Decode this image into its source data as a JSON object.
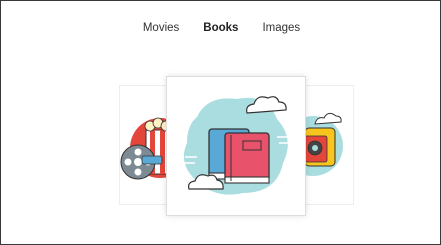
{
  "tabs": [
    {
      "label": "Movies",
      "active": false
    },
    {
      "label": "Books",
      "active": true
    },
    {
      "label": "Images",
      "active": false
    }
  ],
  "carousel": {
    "left_card": {
      "icon": "movies-icon"
    },
    "center_card": {
      "icon": "books-icon"
    },
    "right_card": {
      "icon": "images-icon"
    }
  },
  "colors": {
    "accent_blue": "#a9dde0",
    "book_red": "#e8536b",
    "book_blue": "#5aa8d6",
    "popcorn_red": "#e4463b",
    "camera_red": "#e4463b",
    "camera_yellow": "#f7c51e"
  }
}
